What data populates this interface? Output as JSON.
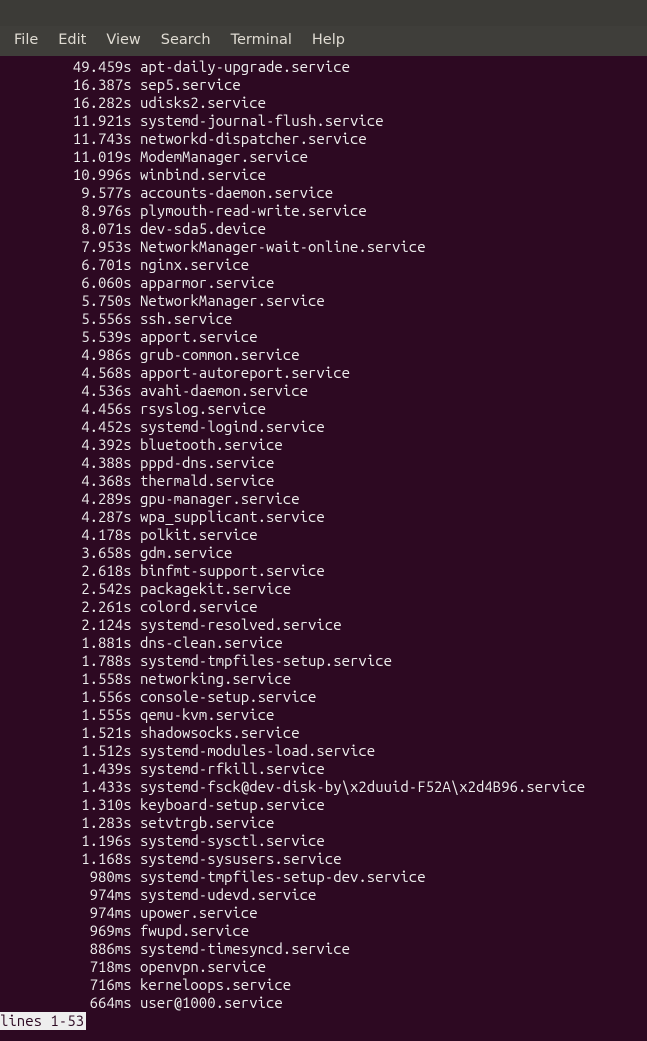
{
  "menu": {
    "file": "File",
    "edit": "Edit",
    "view": "View",
    "search": "Search",
    "terminal": "Terminal",
    "help": "Help"
  },
  "status_line": "lines 1-53",
  "services": [
    {
      "time": "49.459s",
      "name": "apt-daily-upgrade.service"
    },
    {
      "time": "16.387s",
      "name": "sep5.service"
    },
    {
      "time": "16.282s",
      "name": "udisks2.service"
    },
    {
      "time": "11.921s",
      "name": "systemd-journal-flush.service"
    },
    {
      "time": "11.743s",
      "name": "networkd-dispatcher.service"
    },
    {
      "time": "11.019s",
      "name": "ModemManager.service"
    },
    {
      "time": "10.996s",
      "name": "winbind.service"
    },
    {
      "time": "9.577s",
      "name": "accounts-daemon.service"
    },
    {
      "time": "8.976s",
      "name": "plymouth-read-write.service"
    },
    {
      "time": "8.071s",
      "name": "dev-sda5.device"
    },
    {
      "time": "7.953s",
      "name": "NetworkManager-wait-online.service"
    },
    {
      "time": "6.701s",
      "name": "nginx.service"
    },
    {
      "time": "6.060s",
      "name": "apparmor.service"
    },
    {
      "time": "5.750s",
      "name": "NetworkManager.service"
    },
    {
      "time": "5.556s",
      "name": "ssh.service"
    },
    {
      "time": "5.539s",
      "name": "apport.service"
    },
    {
      "time": "4.986s",
      "name": "grub-common.service"
    },
    {
      "time": "4.568s",
      "name": "apport-autoreport.service"
    },
    {
      "time": "4.536s",
      "name": "avahi-daemon.service"
    },
    {
      "time": "4.456s",
      "name": "rsyslog.service"
    },
    {
      "time": "4.452s",
      "name": "systemd-logind.service"
    },
    {
      "time": "4.392s",
      "name": "bluetooth.service"
    },
    {
      "time": "4.388s",
      "name": "pppd-dns.service"
    },
    {
      "time": "4.368s",
      "name": "thermald.service"
    },
    {
      "time": "4.289s",
      "name": "gpu-manager.service"
    },
    {
      "time": "4.287s",
      "name": "wpa_supplicant.service"
    },
    {
      "time": "4.178s",
      "name": "polkit.service"
    },
    {
      "time": "3.658s",
      "name": "gdm.service"
    },
    {
      "time": "2.618s",
      "name": "binfmt-support.service"
    },
    {
      "time": "2.542s",
      "name": "packagekit.service"
    },
    {
      "time": "2.261s",
      "name": "colord.service"
    },
    {
      "time": "2.124s",
      "name": "systemd-resolved.service"
    },
    {
      "time": "1.881s",
      "name": "dns-clean.service"
    },
    {
      "time": "1.788s",
      "name": "systemd-tmpfiles-setup.service"
    },
    {
      "time": "1.558s",
      "name": "networking.service"
    },
    {
      "time": "1.556s",
      "name": "console-setup.service"
    },
    {
      "time": "1.555s",
      "name": "qemu-kvm.service"
    },
    {
      "time": "1.521s",
      "name": "shadowsocks.service"
    },
    {
      "time": "1.512s",
      "name": "systemd-modules-load.service"
    },
    {
      "time": "1.439s",
      "name": "systemd-rfkill.service"
    },
    {
      "time": "1.433s",
      "name": "systemd-fsck@dev-disk-by\\x2duuid-F52A\\x2d4B96.service"
    },
    {
      "time": "1.310s",
      "name": "keyboard-setup.service"
    },
    {
      "time": "1.283s",
      "name": "setvtrgb.service"
    },
    {
      "time": "1.196s",
      "name": "systemd-sysctl.service"
    },
    {
      "time": "1.168s",
      "name": "systemd-sysusers.service"
    },
    {
      "time": "980ms",
      "name": "systemd-tmpfiles-setup-dev.service"
    },
    {
      "time": "974ms",
      "name": "systemd-udevd.service"
    },
    {
      "time": "974ms",
      "name": "upower.service"
    },
    {
      "time": "969ms",
      "name": "fwupd.service"
    },
    {
      "time": "886ms",
      "name": "systemd-timesyncd.service"
    },
    {
      "time": "718ms",
      "name": "openvpn.service"
    },
    {
      "time": "716ms",
      "name": "kerneloops.service"
    },
    {
      "time": "664ms",
      "name": "user@1000.service"
    }
  ]
}
